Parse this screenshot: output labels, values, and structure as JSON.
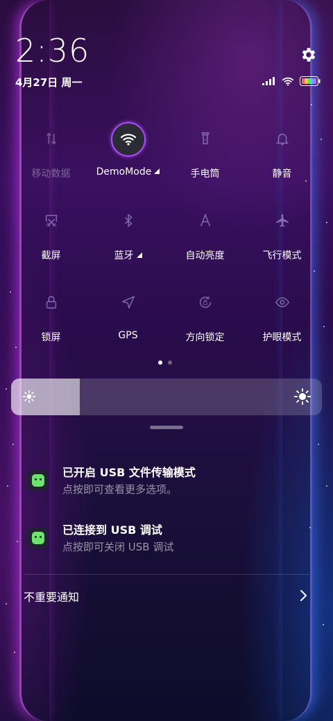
{
  "lockscreen": {
    "time": "2:36",
    "date": "4月27日 周一"
  },
  "icons": {
    "settings": "gear-icon",
    "signal": "signal-icon",
    "wifi": "wifi-icon",
    "battery": "battery-icon"
  },
  "tiles": [
    {
      "label": "移动数据",
      "icon": "mobile-data-icon",
      "active": false
    },
    {
      "label": "DemoMode",
      "icon": "wifi-icon",
      "active": true,
      "expandable": true
    },
    {
      "label": "手电筒",
      "icon": "flashlight-icon",
      "active": false
    },
    {
      "label": "静音",
      "icon": "bell-icon",
      "active": false
    },
    {
      "label": "截屏",
      "icon": "screenshot-icon",
      "active": false
    },
    {
      "label": "蓝牙",
      "icon": "bluetooth-icon",
      "active": false,
      "expandable": true
    },
    {
      "label": "自动亮度",
      "icon": "auto-brightness-icon",
      "active": false
    },
    {
      "label": "飞行模式",
      "icon": "airplane-icon",
      "active": false
    },
    {
      "label": "锁屏",
      "icon": "lock-icon",
      "active": false
    },
    {
      "label": "GPS",
      "icon": "location-icon",
      "active": false
    },
    {
      "label": "方向锁定",
      "icon": "rotation-lock-icon",
      "active": false
    },
    {
      "label": "护眼模式",
      "icon": "eye-icon",
      "active": false
    }
  ],
  "pager": {
    "pages": 2,
    "current": 1
  },
  "brightness": {
    "level": 0.22
  },
  "notifications": [
    {
      "title": "已开启 USB 文件传输模式",
      "subtitle": "点按即可查看更多选项。",
      "icon": "android-robot-icon"
    },
    {
      "title": "已连接到 USB 调试",
      "subtitle": "点按即可关闭 USB 调试",
      "icon": "android-robot-icon"
    }
  ],
  "footer": {
    "unimportant_label": "不重要通知"
  },
  "colors": {
    "active_ring": "#a84bff",
    "battery": [
      "#ff5a7a",
      "#ffd24a",
      "#6ee36b",
      "#4ac8ff",
      "#b96bff"
    ]
  }
}
